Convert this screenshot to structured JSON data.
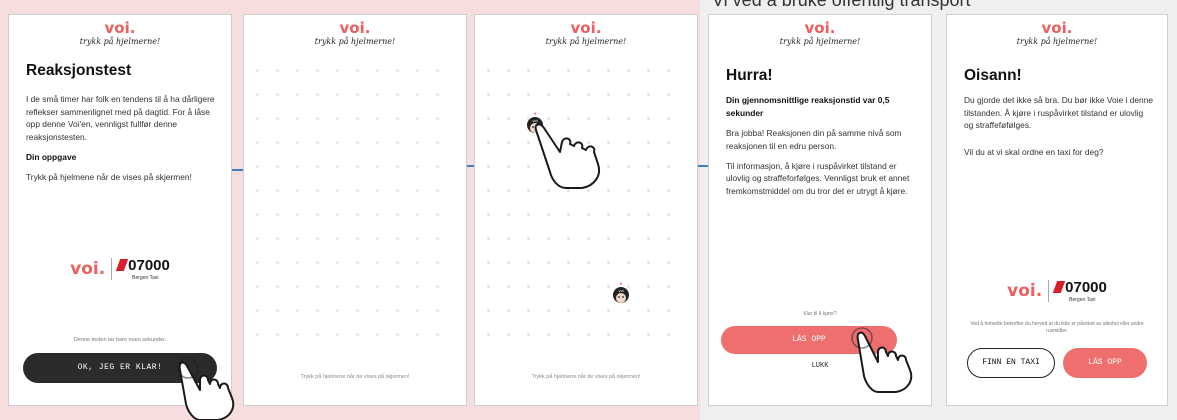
{
  "background": {
    "clipped_text": "Vi ved å bruke offentlig transport"
  },
  "colors": {
    "brand": "#ef5e5e",
    "connector": "#3f7fc4",
    "button_dark": "#2b2b2b",
    "button_red": "#ef6e6e"
  },
  "logo": {
    "brand": "voi.",
    "tagline": "trykk på hjelmerne!"
  },
  "partner": {
    "voi": "voi.",
    "number": "07000",
    "sub": "Bergen Taxi"
  },
  "screen1": {
    "title": "Reaksjonstest",
    "paragraph": "I de små timer har folk en tendens til å ha dårligere reflekser sammenlignet med på dagtid. For å låse opp denne Voi'en, vennligst fullfør denne reaksjonstesten.",
    "task_heading": "Din oppgave",
    "task_text": "Trykk på hjelmene når de vises på skjermen!",
    "footer_note": "Denne testen tar bare noen sekunder.",
    "button_label": "OK, JEG ER KLAR!"
  },
  "screen2": {
    "bottom_note": "Trykk på hjelmene når de vises på skjermen!"
  },
  "screen3": {
    "bottom_note": "Trykk på hjelmene når de vises på skjermen!",
    "helmet_label": "voi"
  },
  "screen4": {
    "title": "Hurra!",
    "subtitle": "Din gjennomsnittlige reaksjonstid var 0,5 sekunder",
    "para1": "Bra jobba! Reaksjonen din på samme nivå som reaksjonen til en edru person.",
    "para2": "Til informasjon, å kjøre i ruspåvirket tilstand er ulovlig og straffeforfølges. Vennligst bruk et annet fremkomstmiddel om du tror det er utrygt å kjøre.",
    "ready_note": "Klar til å kjøre?",
    "unlock_button": "LÅS OPP",
    "close_button": "LUKK"
  },
  "screen5": {
    "title": "Oisann!",
    "para1": "Du gjorde det ikke så bra. Du bør ikke Voie i denne tilstanden. Å kjøre i ruspåvirket tilstand er ulovlig og straffeføfølges.",
    "para2": "Vil du at vi skal ordne en taxi for deg?",
    "legal": "Ved å fortsette bekrefter du herved at du ikke er påvirket av alkohol eller andre rusmidler.",
    "taxi_button": "FINN EN TAXI",
    "unlock_button": "LÅS OPP"
  }
}
